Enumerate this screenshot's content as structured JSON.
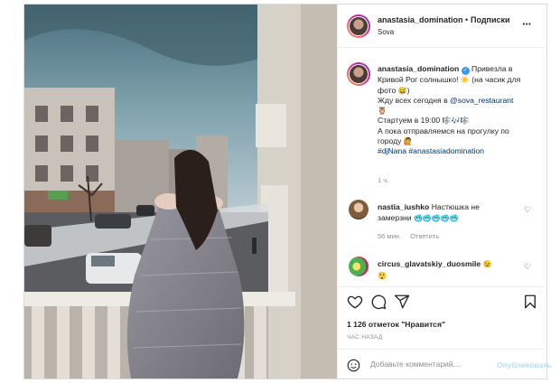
{
  "header": {
    "username": "anastasia_domination",
    "separator": "•",
    "follow_label": "Подписки",
    "location": "Sova",
    "more_icon": "more-horizontal-icon"
  },
  "caption": {
    "username": "anastasia_domination",
    "line1": "Привезла в Кривой Рог солнышко!",
    "line1_tail": "(на часик для фото",
    "line2": "Жду всех сегодня в",
    "mention": "@sova_restaurant",
    "line3": "Стартуем в 19:00",
    "line4": "А пока отправляемся на прогулку по городу",
    "hashtags": "#djNana #anastasiadomination",
    "time": "1 ч."
  },
  "comments": [
    {
      "username": "nastia_iushko",
      "text": "Настюшка не замерзни",
      "time": "56 мин.",
      "reply_label": "Ответить"
    },
    {
      "username": "circus_glavatskiy_duosmile",
      "text": ""
    }
  ],
  "actions": {
    "likes": "1 126 отметок \"Нравится\"",
    "time_ago": "ЧАС НАЗАД",
    "icons": [
      "heart-icon",
      "comment-icon",
      "share-icon",
      "bookmark-icon"
    ]
  },
  "add_comment": {
    "placeholder": "Добавьте комментарий...",
    "publish_label": "Опубликовать"
  },
  "colors": {
    "link_blue": "#00376b",
    "verified_blue": "#3897f0",
    "publish_disabled": "#b2dffc",
    "muted_text": "#8e8e8e",
    "border": "#dbdbdb"
  }
}
